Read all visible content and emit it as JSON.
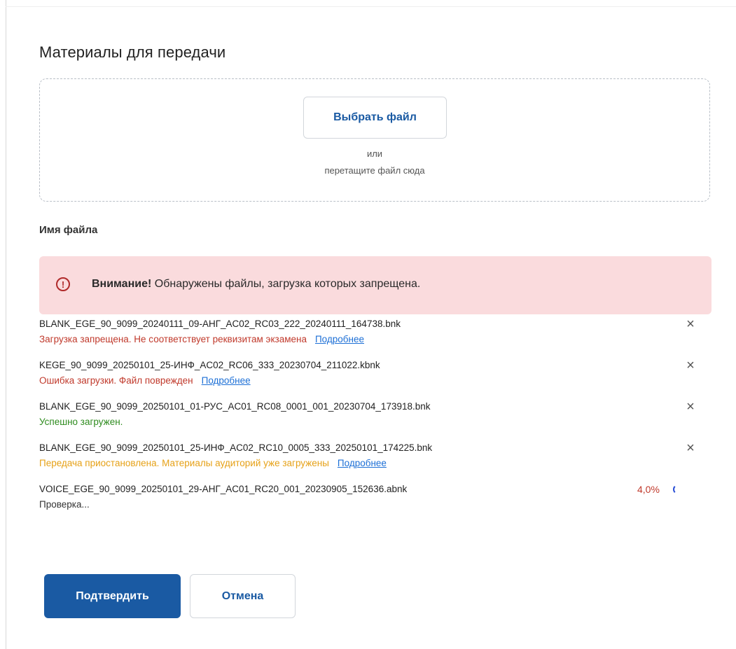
{
  "dialog": {
    "title": "Материалы для передачи"
  },
  "dropzone": {
    "choose_button": "Выбрать файл",
    "or_text": "или",
    "drag_text": "перетащите файл сюда"
  },
  "file_list_header": "Имя файла",
  "alert": {
    "icon": "exclamation-circle-icon",
    "title": "Внимание!",
    "message": "Обнаружены файлы, загрузка которых запрещена."
  },
  "files": [
    {
      "name": "BLANK_EGE_90_9099_20240111_09-АНГ_AC02_RC03_222_20240111_164738.bnk",
      "status": "Загрузка запрещена. Не соответствует реквизитам экзамена",
      "status_type": "error",
      "link": "Подробнее",
      "remove": "×"
    },
    {
      "name": "KEGE_90_9099_20250101_25-ИНФ_AC02_RC06_333_20230704_211022.kbnk",
      "status": "Ошибка загрузки. Файл поврежден",
      "status_type": "error",
      "link": "Подробнее",
      "remove": "×"
    },
    {
      "name": "BLANK_EGE_90_9099_20250101_01-РУС_AC01_RC08_0001_001_20230704_173918.bnk",
      "status": "Успешно загружен.",
      "status_type": "success",
      "remove": "×"
    },
    {
      "name": "BLANK_EGE_90_9099_20250101_25-ИНФ_AC02_RC10_0005_333_20250101_174225.bnk",
      "status": "Передача приостановлена. Материалы аудиторий уже загружены",
      "status_type": "warning",
      "link": "Подробнее",
      "remove": "×"
    },
    {
      "name": "VOICE_EGE_90_9099_20250101_29-АНГ_AC01_RC20_001_20230905_152636.abnk",
      "status": "Проверка...",
      "status_type": "neutral",
      "progress": "4,0%",
      "spinner": "loading-spinner-icon"
    }
  ],
  "actions": {
    "confirm": "Подтвердить",
    "cancel": "Отмена"
  },
  "colors": {
    "primary": "#1a5aa3",
    "error": "#c0392b",
    "success": "#2e8b1e",
    "warning": "#e6a117",
    "link": "#1c6fd6",
    "alert_bg": "#fadbdd"
  }
}
